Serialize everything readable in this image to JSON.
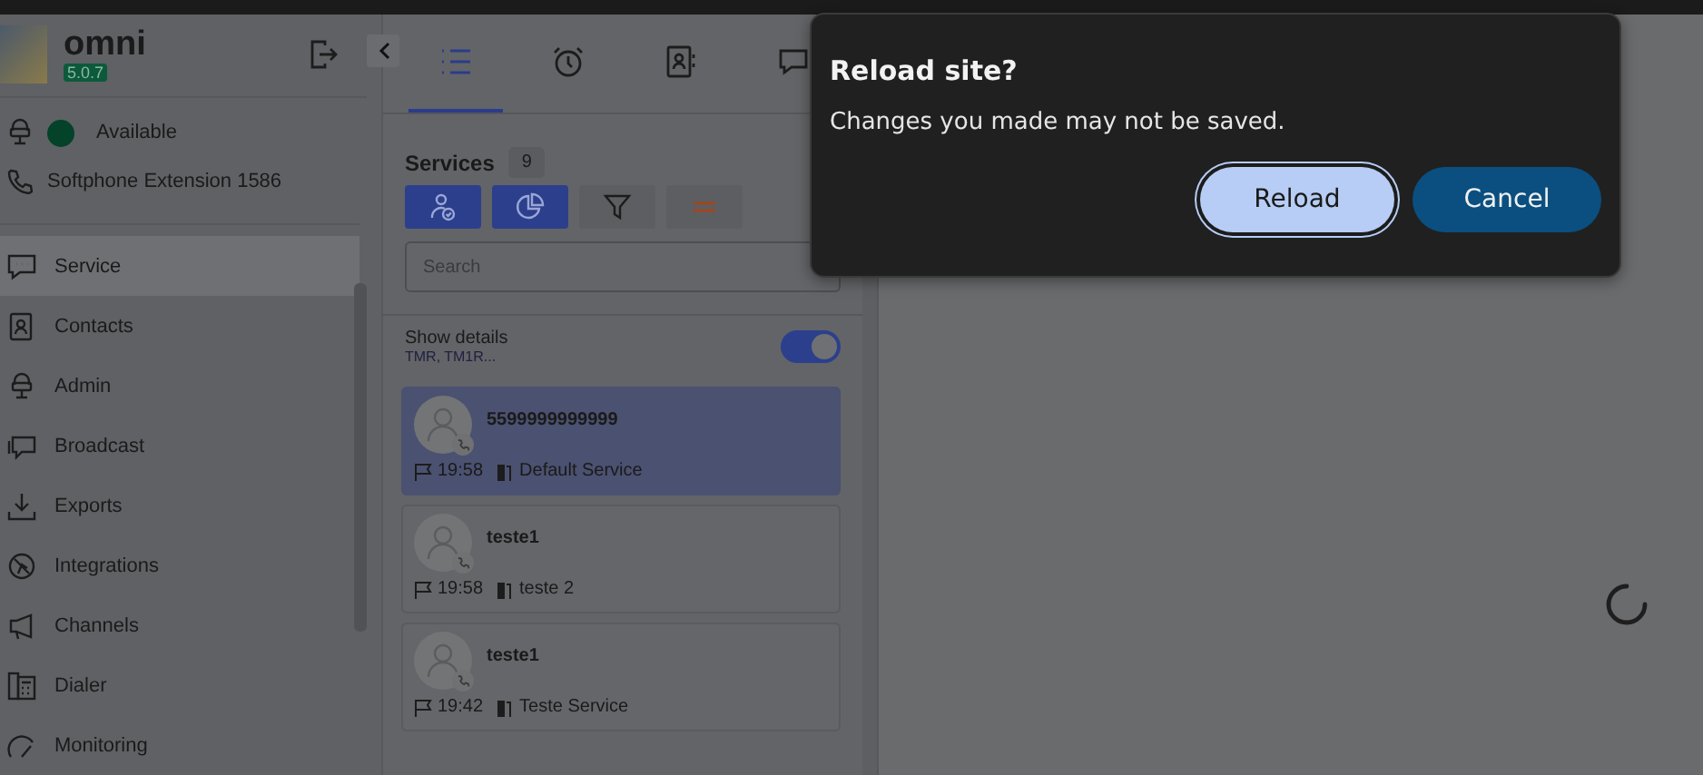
{
  "app": {
    "name": "omni",
    "version": "5.0.7"
  },
  "status": {
    "label": "Available"
  },
  "extension": "Softphone Extension 1586",
  "nav": [
    {
      "label": "Service",
      "selected": true
    },
    {
      "label": "Contacts",
      "selected": false
    },
    {
      "label": "Admin",
      "selected": false
    },
    {
      "label": "Broadcast",
      "selected": false
    },
    {
      "label": "Exports",
      "selected": false
    },
    {
      "label": "Integrations",
      "selected": false
    },
    {
      "label": "Channels",
      "selected": false
    },
    {
      "label": "Dialer",
      "selected": false
    },
    {
      "label": "Monitoring",
      "selected": false
    }
  ],
  "tabs": [
    {
      "selected": true
    },
    {
      "selected": false
    },
    {
      "selected": false
    },
    {
      "selected": false
    }
  ],
  "services": {
    "title": "Services",
    "count": "9",
    "search_placeholder": "Search",
    "filters": [
      {
        "active": true
      },
      {
        "active": true
      },
      {
        "active": false
      },
      {
        "active": false
      }
    ],
    "show_details": {
      "label": "Show details",
      "sub": "TMR, TM1R...",
      "on": true
    },
    "cards": [
      {
        "name": "5599999999999",
        "time": "19:58",
        "queue": "Default Service",
        "selected": true
      },
      {
        "name": "teste1",
        "time": "19:58",
        "queue": "teste 2",
        "selected": false
      },
      {
        "name": "teste1",
        "time": "19:42",
        "queue": "Teste Service",
        "selected": false
      }
    ]
  },
  "dialog": {
    "title": "Reload site?",
    "message": "Changes you made may not be saved.",
    "buttons": [
      {
        "label": "Reload",
        "kind": "primary"
      },
      {
        "label": "Cancel",
        "kind": "secondary"
      }
    ]
  }
}
